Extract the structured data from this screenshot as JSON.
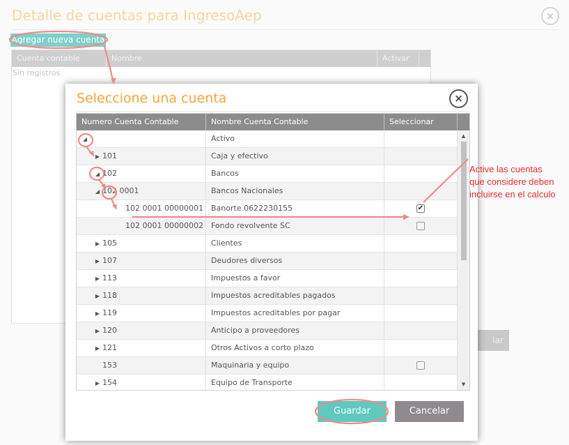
{
  "background_dialog": {
    "title": "Detalle de cuentas para IngresoAep",
    "close_symbol": "×",
    "add_button_label": "Agregar nueva cuenta",
    "columns": [
      "Cuenta contable",
      "Nombre",
      "Activar"
    ],
    "empty_text": "Sin registros",
    "cancel_partial_label": "lar"
  },
  "modal": {
    "title": "Seleccione una cuenta",
    "close_symbol": "×",
    "columns": [
      "Numero Cuenta Contable",
      "Nombre Cuenta Contable",
      "Seleccionar"
    ],
    "rows": [
      {
        "number": "",
        "name": "Activo",
        "level": 0,
        "expander": "expanded",
        "checkbox": "none"
      },
      {
        "number": "101",
        "name": "Caja y efectivo",
        "level": 1,
        "expander": "collapsed",
        "checkbox": "none"
      },
      {
        "number": "102",
        "name": "Bancos",
        "level": 1,
        "expander": "expanded",
        "checkbox": "none"
      },
      {
        "number": "102 0001",
        "name": "Bancos Nacionales",
        "level": 2,
        "expander": "expanded",
        "checkbox": "none"
      },
      {
        "number": "102 0001 00000001",
        "name": "Banorte 0622230155",
        "level": 3,
        "expander": "none",
        "checkbox": "checked"
      },
      {
        "number": "102 0001 00000002",
        "name": "Fondo revolvente SC",
        "level": 3,
        "expander": "none",
        "checkbox": "unchecked"
      },
      {
        "number": "105",
        "name": "Clientes",
        "level": 1,
        "expander": "collapsed",
        "checkbox": "none"
      },
      {
        "number": "107",
        "name": "Deudores diversos",
        "level": 1,
        "expander": "collapsed",
        "checkbox": "none"
      },
      {
        "number": "113",
        "name": "Impuestos a favor",
        "level": 1,
        "expander": "collapsed",
        "checkbox": "none"
      },
      {
        "number": "118",
        "name": "Impuestos acreditables pagados",
        "level": 1,
        "expander": "collapsed",
        "checkbox": "none"
      },
      {
        "number": "119",
        "name": "Impuestos acreditables por pagar",
        "level": 1,
        "expander": "collapsed",
        "checkbox": "none"
      },
      {
        "number": "120",
        "name": "Anticipo a proveedores",
        "level": 1,
        "expander": "collapsed",
        "checkbox": "none"
      },
      {
        "number": "121",
        "name": "Otros Activos a corto plazo",
        "level": 1,
        "expander": "collapsed",
        "checkbox": "none"
      },
      {
        "number": "153",
        "name": "Maquinaria y equipo",
        "level": 1,
        "expander": "none",
        "checkbox": "unchecked"
      },
      {
        "number": "154",
        "name": "Equipo de Transporte",
        "level": 1,
        "expander": "collapsed",
        "checkbox": "none"
      }
    ],
    "save_label": "Guardar",
    "cancel_label": "Cancelar"
  },
  "annotation": {
    "lines": [
      "Active las cuentas",
      "que considere deben",
      "incluirse en el calculo"
    ],
    "color": "#e82a2a",
    "highlight_color": "#f08a8a"
  },
  "colors": {
    "accent_title": "#f3a43b",
    "teal_button": "#5fc9bf",
    "grey_button": "#8e8a8e",
    "grid_header": "#8c8c8c"
  }
}
